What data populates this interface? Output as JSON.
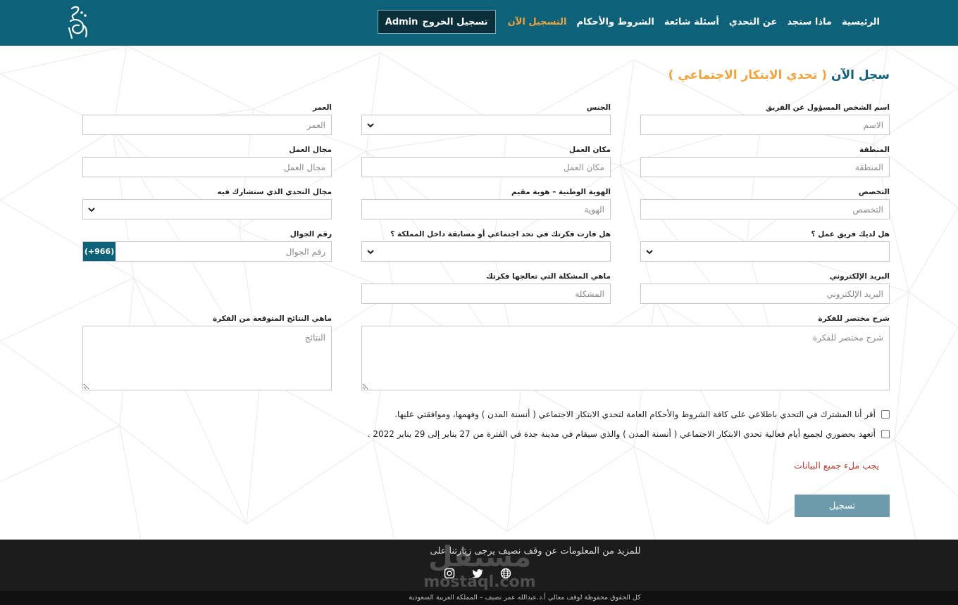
{
  "colors": {
    "primary": "#0d6178",
    "accent": "#f2a33a",
    "error": "#c0392b",
    "button": "#6d9bab",
    "footer": "#1c1c1c"
  },
  "nav": {
    "items": [
      "الرئيسية",
      "ماذا ستجد",
      "عن التحدي",
      "أسئلة شائعة",
      "الشروط والأحكام",
      "التسجيل الآن"
    ],
    "logout_label": "تسجيل الخروج",
    "user_label": "Admin"
  },
  "page": {
    "title": "سجل الآن",
    "title_accent": "( تحدي الابتكار الاجتماعي )"
  },
  "form": {
    "name_label": "اسم الشخص المسؤول عن الفريق",
    "name_placeholder": "الاسم",
    "gender_label": "الجنس",
    "age_label": "العمر",
    "age_placeholder": "العمر",
    "region_label": "المنطقة",
    "region_placeholder": "المنطقة",
    "workplace_label": "مكان العمل",
    "workplace_placeholder": "مكان العمل",
    "workfield_label": "مجال العمل",
    "workfield_placeholder": "مجال العمل",
    "specialty_label": "التخصص",
    "specialty_placeholder": "التخصص",
    "id_label": "الهوية الوطنية – هوية مقيم",
    "id_placeholder": "الهوية",
    "challenge_field_label": "مجال التحدي الذي ستشارك فيه",
    "has_team_label": "هل لديك فريق عمل ؟",
    "won_before_label": "هل فازت فكرتك في تحد اجتماعي أو مسابقة داخل المملكة ؟",
    "phone_label": "رقم الجوال",
    "phone_placeholder": "رقم الجوال",
    "phone_prefix": "(+966)",
    "email_label": "البريد الإلكتروني",
    "email_placeholder": "البريد الإلكتروني",
    "problem_label": "ماهي المشكلة التي تعالجها فكرتك",
    "problem_placeholder": "المشكلة",
    "idea_label": "شرح مختصر للفكرة",
    "idea_placeholder": "شرح مختصر للفكرة",
    "results_label": "ماهي النتائج المتوقعة من الفكرة",
    "results_placeholder": "النتائج",
    "consent_1": "أقر أنا المشترك في التحدي باطلاعي على كافة الشروط والأحكام العامة لتحدي الابتكار الاجتماعي ( أنسنة المدن ) وفهمها، وموافقتي عليها.",
    "consent_2": "أتعهد بحضوري لجميع أيام فعالية تحدي الابتكار الاجتماعي ( أنسنة المدن ) والذي سيقام في مدينة جدة في الفترة من 27 يناير إلى 29 يناير 2022 .",
    "error": "يجب ملء جميع البيانات",
    "submit": "تسجيل"
  },
  "footer": {
    "info": "للمزيد من المعلومات عن وقف نصيف يرجى زيارتنا على",
    "copyright": "كل الحقوق محفوظة لوقف معالي أ.د.عبدالله عمر نصيف – المملكة العربية السعودية",
    "watermark_ar": "مستقل",
    "watermark_en": "mostaql.com",
    "icons": [
      "instagram-icon",
      "twitter-icon",
      "globe-icon"
    ]
  }
}
